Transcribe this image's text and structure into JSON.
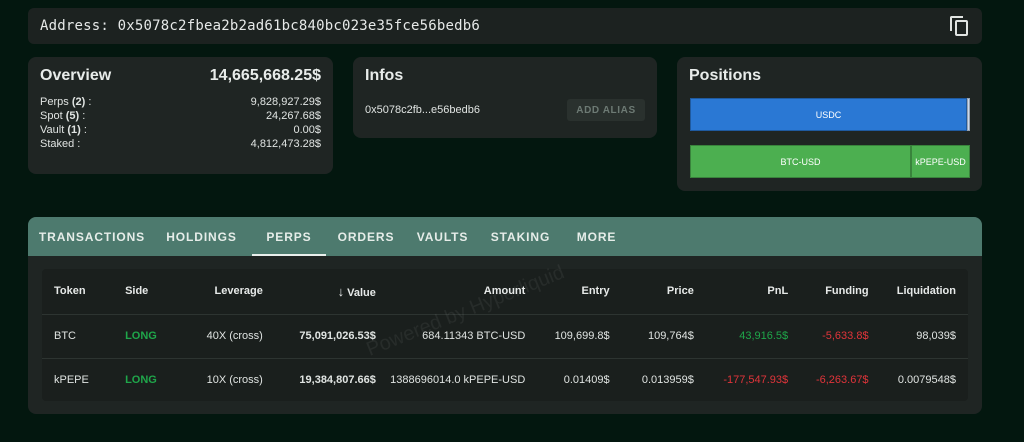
{
  "address_bar": {
    "text": "Address: 0x5078c2fbea2b2ad61bc840bc023e35fce56bedb6",
    "copy_icon": "copy-icon"
  },
  "overview": {
    "title": "Overview",
    "total": "14,665,668.25$",
    "rows": [
      {
        "label": "Perps",
        "count": "(2)",
        "suffix": " :",
        "value": "9,828,927.29$"
      },
      {
        "label": "Spot",
        "count": "(5)",
        "suffix": " :",
        "value": "24,267.68$"
      },
      {
        "label": "Vault",
        "count": "(1)",
        "suffix": " :",
        "value": "0.00$"
      },
      {
        "label": "Staked",
        "count": "",
        "suffix": " :",
        "value": "4,812,473.28$"
      }
    ]
  },
  "infos": {
    "title": "Infos",
    "address_short": "0x5078c2fb...e56bedb6",
    "alias_button": "ADD ALIAS"
  },
  "positions": {
    "title": "Positions",
    "spot_segments": [
      {
        "label": "USDC",
        "color": "#2a78d4"
      }
    ],
    "perp_segments": [
      {
        "label": "BTC-USD",
        "color": "#4caf50"
      },
      {
        "label": "kPEPE-USD",
        "color": "#4caf50"
      }
    ]
  },
  "tabs": [
    {
      "label": "TRANSACTIONS",
      "active": false
    },
    {
      "label": "HOLDINGS",
      "active": false
    },
    {
      "label": "PERPS",
      "active": true
    },
    {
      "label": "ORDERS",
      "active": false
    },
    {
      "label": "VAULTS",
      "active": false
    },
    {
      "label": "STAKING",
      "active": false
    },
    {
      "label": "MORE",
      "active": false
    }
  ],
  "table": {
    "headers": [
      "Token",
      "Side",
      "Leverage",
      "Value",
      "Amount",
      "Entry",
      "Price",
      "PnL",
      "Funding",
      "Liquidation"
    ],
    "sort_icon": "arrow-down-icon",
    "rows": [
      {
        "token": "BTC",
        "side": "LONG",
        "leverage": "40X (cross)",
        "value": "75,091,026.53$",
        "amount": "684.11343 BTC-USD",
        "entry": "109,699.8$",
        "price": "109,764$",
        "pnl": "43,916.5$",
        "funding": "-5,633.8$",
        "liquidation": "98,039$"
      },
      {
        "token": "kPEPE",
        "side": "LONG",
        "leverage": "10X (cross)",
        "value": "19,384,807.66$",
        "amount": "1388696014.0 kPEPE-USD",
        "entry": "0.01409$",
        "price": "0.013959$",
        "pnl": "-177,547.93$",
        "funding": "-6,263.67$",
        "liquidation": "0.0079548$"
      }
    ]
  },
  "watermark": "Powered by Hyperliquid",
  "colors": {
    "accent": "#4d7a6e",
    "long": "#1fa64a",
    "negative": "#e0343a",
    "usdc": "#2a78d4"
  }
}
